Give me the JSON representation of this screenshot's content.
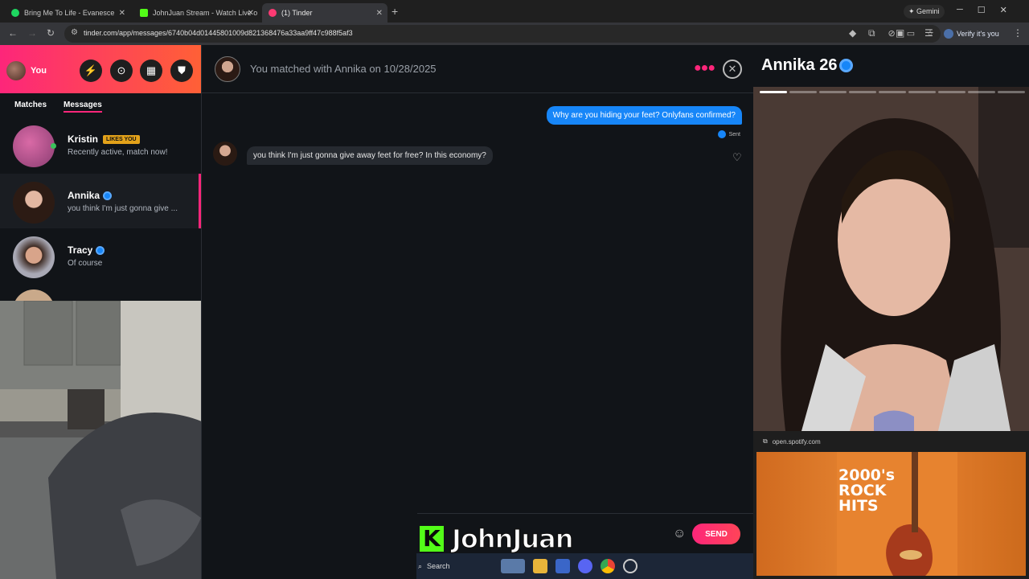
{
  "browser": {
    "tabs": [
      {
        "title": "Bring Me To Life - Evanesce",
        "favicon_color": "#1ed760",
        "active": false
      },
      {
        "title": "JohnJuan Stream - Watch Live o",
        "favicon_color": "#53fc18",
        "active": false
      },
      {
        "title": "(1) Tinder",
        "favicon_color": "#fd3a73",
        "active": true
      }
    ],
    "url": "tinder.com/app/messages/6740b04d01445801009d821368476a33aa9ff47c988f5af3",
    "gemini_label": "Gemini",
    "verify_label": "Verify it's you"
  },
  "sidebar": {
    "you_label": "You",
    "tabs": {
      "matches": "Matches",
      "messages": "Messages"
    },
    "matches": [
      {
        "name": "Kristin",
        "badge": "LIKES YOU",
        "subtitle": "Recently active, match now!",
        "online": true
      },
      {
        "name": "Annika",
        "verified": true,
        "subtitle": "you think I'm just gonna give ...",
        "active": true
      },
      {
        "name": "Tracy",
        "verified": true,
        "subtitle": "Of course"
      }
    ]
  },
  "chat": {
    "header": "You matched with Annika on 10/28/2025",
    "messages": [
      {
        "direction": "out",
        "text": "Why are you hiding your feet? Onlyfans confirmed?",
        "status": "Sent"
      },
      {
        "direction": "in",
        "text": "you think I'm just gonna give away feet for free? In this economy?"
      }
    ],
    "send_label": "SEND"
  },
  "stream": {
    "streamer": "JohnJuan",
    "logo": "K"
  },
  "taskbar": {
    "search_placeholder": "Search"
  },
  "profile": {
    "name_age": "Annika 26",
    "photo_count": 9
  },
  "spotify": {
    "url": "open.spotify.com",
    "playlist_title": "2000's ROCK HITS"
  },
  "colors": {
    "tinder_pink": "#fd267a",
    "tinder_orange": "#ff6036",
    "verified_blue": "#1786f8",
    "kick_green": "#53fc18"
  }
}
